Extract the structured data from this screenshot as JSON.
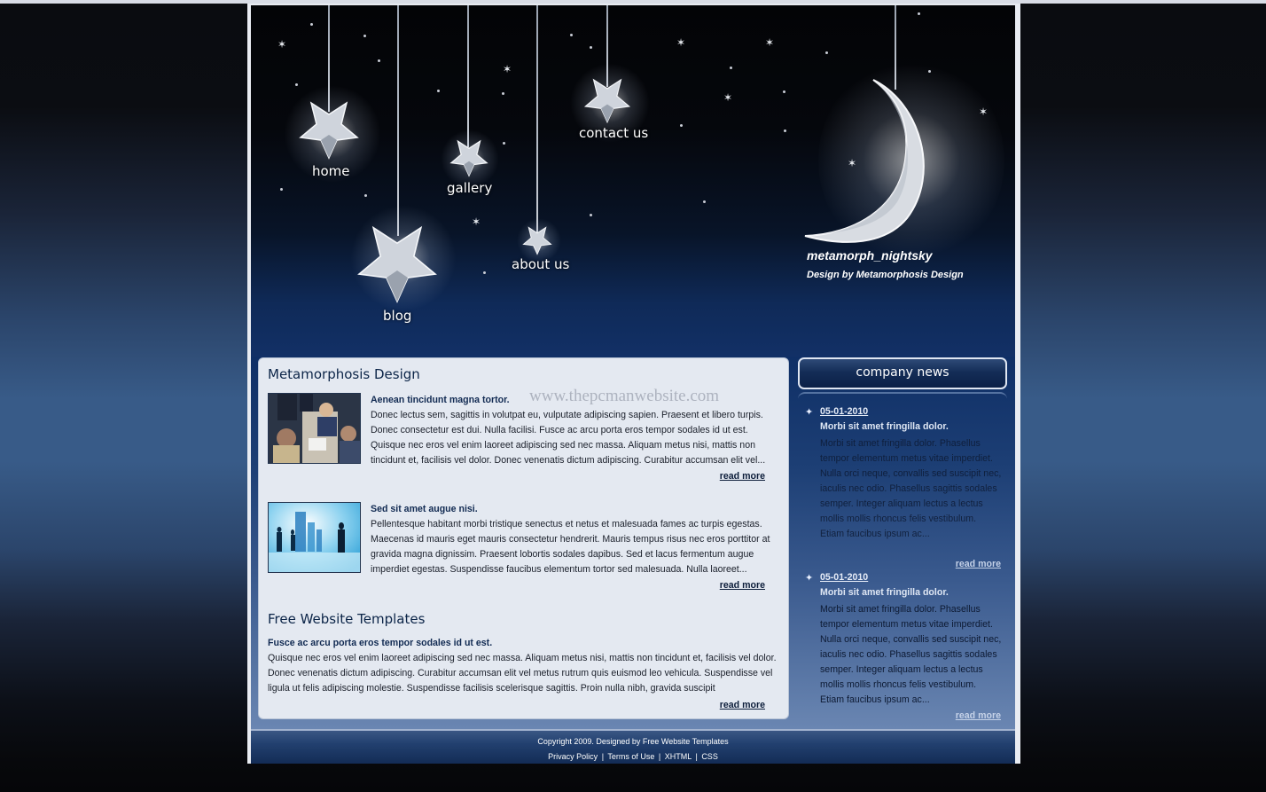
{
  "nav": [
    {
      "label": "home"
    },
    {
      "label": "gallery"
    },
    {
      "label": "blog"
    },
    {
      "label": "about us"
    },
    {
      "label": "contact us"
    }
  ],
  "brand": {
    "name": "metamorph_nightsky",
    "tagline": "Design by Metamorphosis Design"
  },
  "main": {
    "section1_title": "Metamorphosis Design",
    "watermark": "www.thepcmanwebsite.com",
    "articles": [
      {
        "title": "Aenean tincidunt magna tortor.",
        "body": "Donec lectus sem, sagittis in volutpat eu, vulputate adipiscing sapien. Praesent et libero turpis. Donec consectetur est dui. Nulla facilisi. Fusce ac arcu porta eros tempor sodales id ut est. Quisque nec eros vel enim laoreet adipiscing sed nec massa. Aliquam metus nisi, mattis non tincidunt et, facilisis vel dolor. Donec venenatis dictum adipiscing. Curabitur accumsan elit vel...",
        "read_more": "read more",
        "image": "business-meeting-photo"
      },
      {
        "title": "Sed sit amet augue nisi.",
        "body": "Pellentesque habitant morbi tristique senectus et netus et malesuada fames ac turpis egestas. Maecenas id mauris eget mauris consectetur hendrerit. Mauris tempus risus nec eros porttitor at gravida magna dignissim. Praesent lobortis sodales dapibus. Sed et lacus fermentum augue imperdiet egestas. Suspendisse faucibus elementum tortor sed malesuada. Nulla laoreet...",
        "read_more": "read more",
        "image": "business-silhouettes-photo"
      }
    ],
    "section2_title": "Free Website Templates",
    "section2": {
      "title": "Fusce ac arcu porta eros tempor sodales id ut est.",
      "body": "Quisque nec eros vel enim laoreet adipiscing sed nec massa. Aliquam metus nisi, mattis non tincidunt et, facilisis vel dolor. Donec venenatis dictum adipiscing. Curabitur accumsan elit vel metus rutrum quis euismod leo vehicula. Suspendisse vel ligula ut felis adipiscing molestie. Suspendisse facilisis scelerisque sagittis. Proin nulla nibh, gravida suscipit",
      "read_more": "read more"
    }
  },
  "news": {
    "heading": "company news",
    "items": [
      {
        "date": "05-01-2010",
        "title": "Morbi sit amet fringilla dolor.",
        "body": "Morbi sit amet fringilla dolor. Phasellus tempor elementum metus vitae imperdiet. Nulla orci neque, convallis sed suscipit nec, iaculis nec odio. Phasellus sagittis sodales semper. Integer aliquam lectus a lectus mollis mollis rhoncus felis vestibulum. Etiam faucibus ipsum ac...",
        "read_more": "read more"
      },
      {
        "date": "05-01-2010",
        "title": "Morbi sit amet fringilla dolor.",
        "body": "Morbi sit amet fringilla dolor. Phasellus tempor elementum metus vitae imperdiet. Nulla orci neque, convallis sed suscipit nec, iaculis nec odio. Phasellus sagittis sodales semper. Integer aliquam lectus a lectus mollis mollis rhoncus felis vestibulum. Etiam faucibus ipsum ac...",
        "read_more": "read more"
      }
    ]
  },
  "footer": {
    "copyright": "Copyright 2009. Designed by Free Website Templates",
    "links": [
      "Privacy Policy",
      "Terms of Use",
      "XHTML",
      "CSS"
    ],
    "separator": "|"
  },
  "colors": {
    "panel_bg": "#e4e9f1",
    "heading": "#0c2548",
    "night_sky": "#05070c",
    "header_blue": "#123066"
  }
}
